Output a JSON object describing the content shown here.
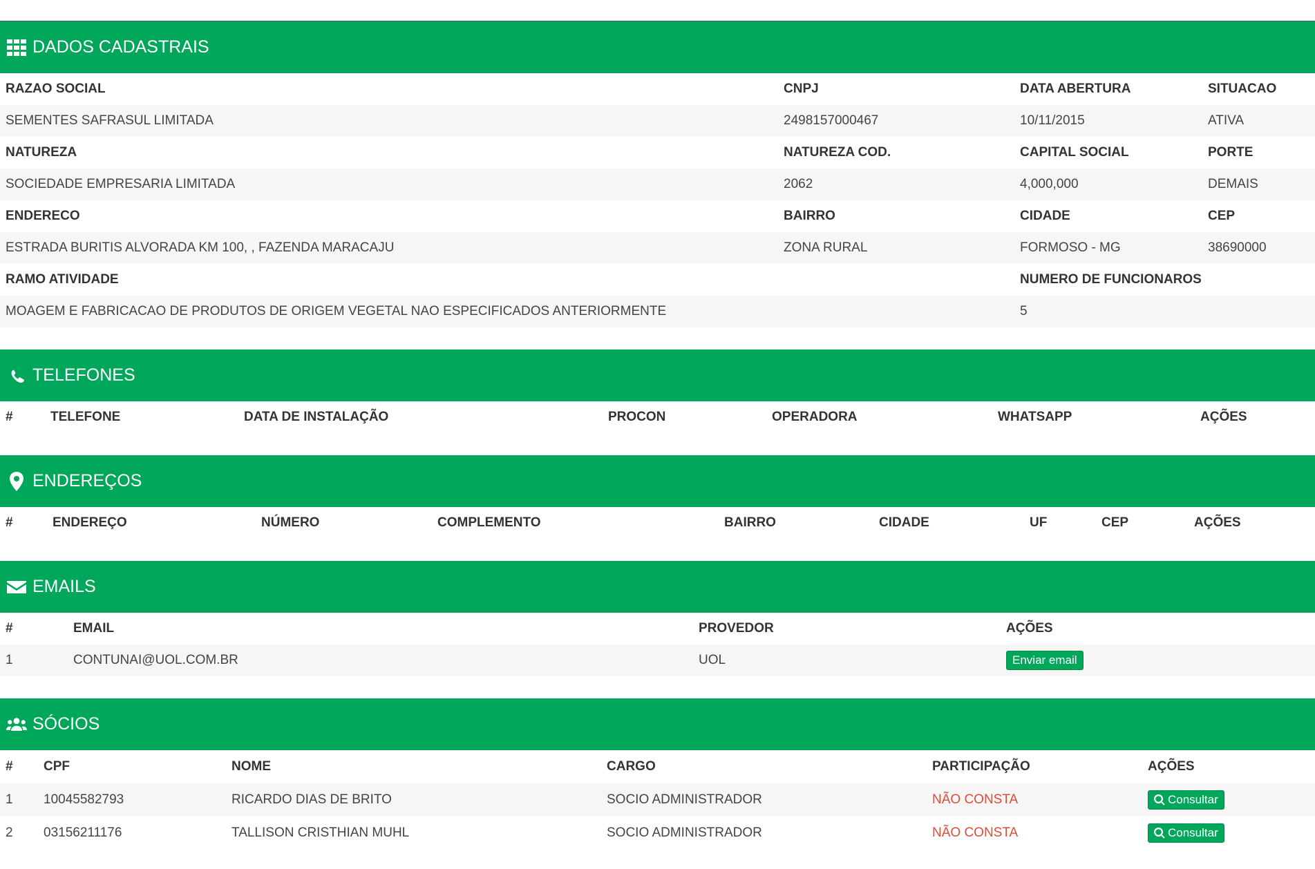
{
  "dados": {
    "title": "DADOS CADASTRAIS",
    "rows": [
      {
        "c1": "RAZAO SOCIAL",
        "c2": "CNPJ",
        "c3": "DATA ABERTURA",
        "c4": "SITUACAO"
      },
      {
        "c1": "SEMENTES SAFRASUL LIMITADA",
        "c2": "2498157000467",
        "c3": "10/11/2015",
        "c4": "ATIVA"
      },
      {
        "c1": "NATUREZA",
        "c2": "NATUREZA COD.",
        "c3": "CAPITAL SOCIAL",
        "c4": "PORTE"
      },
      {
        "c1": "SOCIEDADE EMPRESARIA LIMITADA",
        "c2": "2062",
        "c3": "4,000,000",
        "c4": "DEMAIS"
      },
      {
        "c1": "ENDERECO",
        "c2": "BAIRRO",
        "c3": "CIDADE",
        "c4": "CEP"
      },
      {
        "c1": "ESTRADA BURITIS ALVORADA KM 100, , FAZENDA MARACAJU",
        "c2": "ZONA RURAL",
        "c3": "FORMOSO - MG",
        "c4": "38690000"
      },
      {
        "c1": "RAMO ATIVIDADE",
        "c3": "NUMERO DE FUNCIONAROS"
      },
      {
        "c1": "MOAGEM E FABRICACAO DE PRODUTOS DE ORIGEM VEGETAL NAO ESPECIFICADOS ANTERIORMENTE",
        "c3": "5"
      }
    ]
  },
  "telefones": {
    "title": "TELEFONES",
    "columns": [
      "#",
      "TELEFONE",
      "DATA DE INSTALAÇÃO",
      "PROCON",
      "OPERADORA",
      "WHATSAPP",
      "AÇÕES"
    ]
  },
  "enderecos": {
    "title": "ENDEREÇOS",
    "columns": [
      "#",
      "ENDEREÇO",
      "NÚMERO",
      "COMPLEMENTO",
      "BAIRRO",
      "CIDADE",
      "UF",
      "CEP",
      "AÇÕES"
    ]
  },
  "emails": {
    "title": "EMAILS",
    "columns": [
      "#",
      "EMAIL",
      "PROVEDOR",
      "AÇÕES"
    ],
    "rows": [
      {
        "num": "1",
        "email": "CONTUNAI@UOL.COM.BR",
        "provedor": "UOL",
        "action": "Enviar email"
      }
    ]
  },
  "socios": {
    "title": "SÓCIOS",
    "columns": [
      "#",
      "CPF",
      "NOME",
      "CARGO",
      "PARTICIPAÇÃO",
      "AÇÕES"
    ],
    "rows": [
      {
        "num": "1",
        "cpf": "10045582793",
        "nome": "RICARDO DIAS DE BRITO",
        "cargo": "SOCIO ADMINISTRADOR",
        "participacao": "NÃO CONSTA",
        "action": "Consultar"
      },
      {
        "num": "2",
        "cpf": "03156211176",
        "nome": "TALLISON CRISTHIAN MUHL",
        "cargo": "SOCIO ADMINISTRADOR",
        "participacao": "NÃO CONSTA",
        "action": "Consultar"
      }
    ]
  },
  "colors": {
    "accent": "#00a65a",
    "danger": "#dd4b39"
  }
}
